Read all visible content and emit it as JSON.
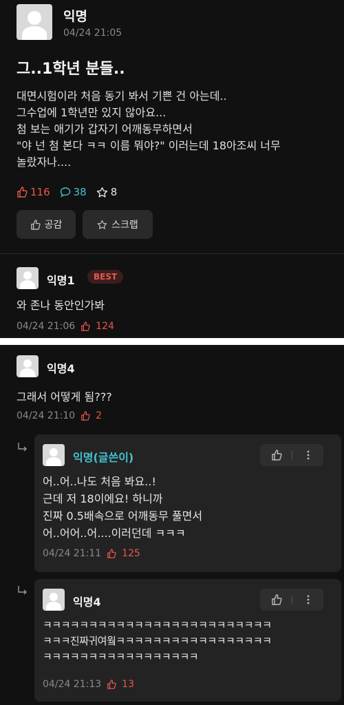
{
  "post": {
    "author": "익명",
    "time": "04/24 21:05",
    "title": "그..1학년 분들..",
    "body": [
      "대면시험이라 처음 동기 봐서 기쁜 건 아는데..",
      "그수업에 1학년만 있지 않아요...",
      "첨 보는 애기가 갑자기 어깨동무하면서",
      "\"야 넌 첨 본다 ㅋㅋ 이름 뭐야?\" 이러는데 18아조씨 너무",
      "놀랐자나...."
    ],
    "likes": "116",
    "comments": "38",
    "scraps": "8",
    "like_button": "공감",
    "scrap_button": "스크랩"
  },
  "best_comment": {
    "author": "익명1",
    "badge": "BEST",
    "text": "와 존나 동안인가봐",
    "time": "04/24 21:06",
    "likes": "124"
  },
  "comment4": {
    "author": "익명4",
    "text": "그래서 어떻게 됨???",
    "time": "04/24 21:10",
    "likes": "2"
  },
  "reply1": {
    "author": "익명(글쓴이)",
    "lines": [
      "어..어..나도 처음 봐요..!",
      "근데 저 18이에요! 하니까",
      "진짜 0.5배속으로 어깨동무 풀면서",
      "어..어어..어....이러던데 ㅋㅋㅋ"
    ],
    "time": "04/24 21:11",
    "likes": "125"
  },
  "reply2": {
    "author": "익명4",
    "lines": [
      "ㅋㅋㅋㅋㅋㅋㅋㅋㅋㅋㅋㅋㅋㅋㅋㅋㅋㅋㅋㅋㅋㅋㅋㅋㅋ",
      "ㅋㅋㅋ진짜귀여웤ㅋㅋㅋㅋㅋㅋㅋㅋㅋㅋㅋㅋㅋㅋㅋㅋㅋ",
      "ㅋㅋㅋㅋㅋㅋㅋㅋㅋㅋㅋㅋㅋㅋㅋㅋㅋ"
    ],
    "time": "04/24 21:13",
    "likes": "13"
  }
}
